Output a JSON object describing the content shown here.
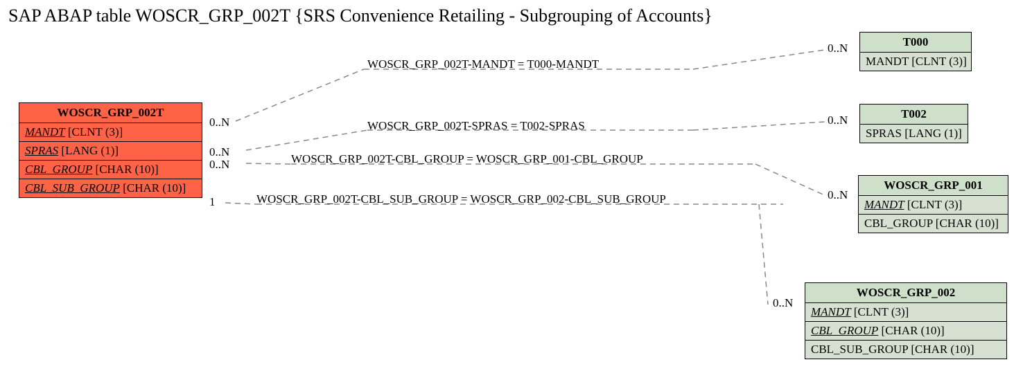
{
  "title": "SAP ABAP table WOSCR_GRP_002T {SRS Convenience Retailing - Subgrouping of Accounts}",
  "main": {
    "name": "WOSCR_GRP_002T",
    "fields": [
      {
        "fk": "MANDT",
        "type": " [CLNT (3)]"
      },
      {
        "fk": "SPRAS",
        "type": " [LANG (1)]"
      },
      {
        "fk": "CBL_GROUP",
        "type": " [CHAR (10)]"
      },
      {
        "fk": "CBL_SUB_GROUP",
        "type": " [CHAR (10)]"
      }
    ]
  },
  "t000": {
    "name": "T000",
    "fields": [
      {
        "plain": "MANDT [CLNT (3)]"
      }
    ]
  },
  "t002": {
    "name": "T002",
    "fields": [
      {
        "plain": "SPRAS [LANG (1)]"
      }
    ]
  },
  "grp001": {
    "name": "WOSCR_GRP_001",
    "fields": [
      {
        "fk": "MANDT",
        "type": " [CLNT (3)]"
      },
      {
        "plain": "CBL_GROUP [CHAR (10)]"
      }
    ]
  },
  "grp002": {
    "name": "WOSCR_GRP_002",
    "fields": [
      {
        "fk": "MANDT",
        "type": " [CLNT (3)]"
      },
      {
        "fk": "CBL_GROUP",
        "type": " [CHAR (10)]"
      },
      {
        "plain": "CBL_SUB_GROUP [CHAR (10)]"
      }
    ]
  },
  "rel": {
    "r1": "WOSCR_GRP_002T-MANDT = T000-MANDT",
    "r2": "WOSCR_GRP_002T-SPRAS = T002-SPRAS",
    "r3": "WOSCR_GRP_002T-CBL_GROUP = WOSCR_GRP_001-CBL_GROUP",
    "r4": "WOSCR_GRP_002T-CBL_SUB_GROUP = WOSCR_GRP_002-CBL_SUB_GROUP"
  },
  "card": {
    "left1": "0..N",
    "left2": "0..N",
    "left3": "0..N",
    "left4": "1",
    "right1": "0..N",
    "right2": "0..N",
    "right3": "0..N",
    "right4": "0..N"
  }
}
